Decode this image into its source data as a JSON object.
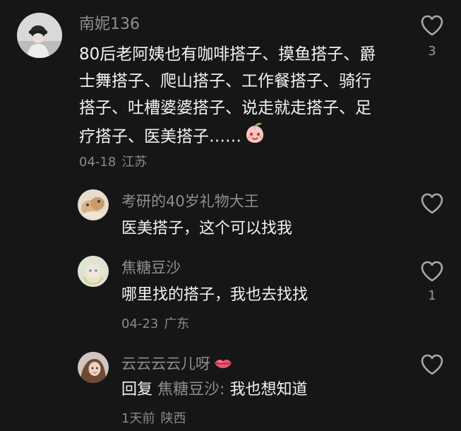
{
  "comments": [
    {
      "user": "南妮136",
      "text": "80后老阿姨也有咖啡搭子、摸鱼搭子、爵士舞搭子、爬山搭子、工作餐搭子、骑行搭子、吐槽婆婆搭子、说走就走搭子、足疗搭子、医美搭子……",
      "date": "04-18",
      "location": "江苏",
      "likes": "3",
      "trailing_emoji": "peach-face-emoji"
    },
    {
      "user": "考研的40岁礼物大王",
      "text": "医美搭子，这个可以找我",
      "likes": ""
    },
    {
      "user": "焦糖豆沙",
      "text": "哪里找的搭子，我也去找找",
      "date": "04-23",
      "location": "广东",
      "likes": "1"
    },
    {
      "user": "云云云云儿呀",
      "user_emoji": "lips-emoji",
      "reply_prefix": "回复",
      "reply_to": "焦糖豆沙:",
      "text": "我也想知道",
      "date": "1天前",
      "location": "陕西",
      "likes": ""
    }
  ],
  "icons": {
    "like": "heart-outline-icon"
  },
  "colors": {
    "background": "#161616",
    "text": "#f3f3f3",
    "username": "#8e8e8e",
    "meta": "#8a8a8a"
  }
}
